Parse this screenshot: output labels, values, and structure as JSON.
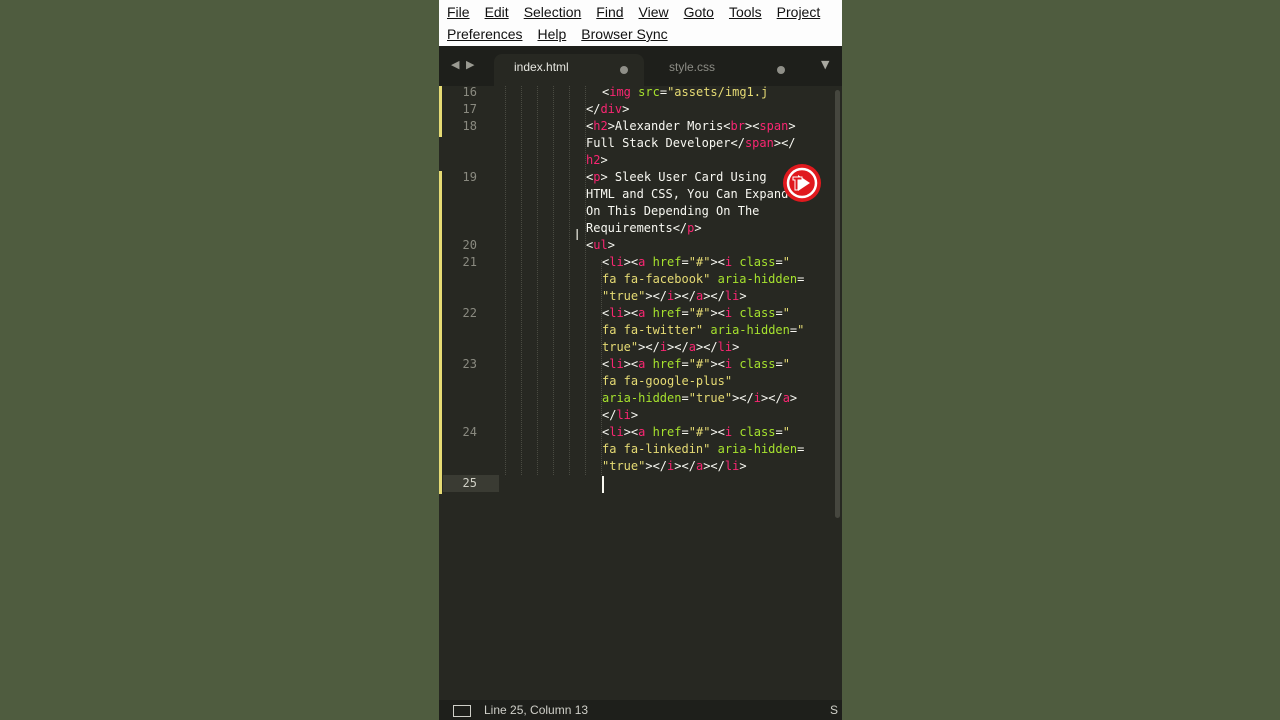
{
  "menu": {
    "row1": [
      "File",
      "Edit",
      "Selection",
      "Find",
      "View",
      "Goto",
      "Tools",
      "Project"
    ],
    "row2": [
      "Preferences",
      "Help",
      "Browser Sync"
    ]
  },
  "tabs": [
    {
      "label": "index.html",
      "active": true,
      "modified": true
    },
    {
      "label": "style.css",
      "active": false,
      "modified": true
    }
  ],
  "editor": {
    "line_numbers": [
      "16",
      "17",
      "18",
      "19",
      "20",
      "21",
      "22",
      "23",
      "24",
      "25"
    ],
    "current_line": "25"
  },
  "status": {
    "position": "Line 25, Column 13",
    "syntax": "S"
  },
  "icons": {
    "nav_back": "chevron-left-icon",
    "nav_forward": "chevron-right-icon",
    "tab_dropdown": "chevron-down-icon",
    "panel": "panel-toggle-icon",
    "channel_logo": "play-logo-icon"
  },
  "colors": {
    "editor_bg": "#272822",
    "tag": "#f92672",
    "attribute": "#a6e22e",
    "string": "#e6db74",
    "text": "#f8f8f2",
    "desktop_bg": "#4f5c3f",
    "logo": "#e0191e"
  }
}
